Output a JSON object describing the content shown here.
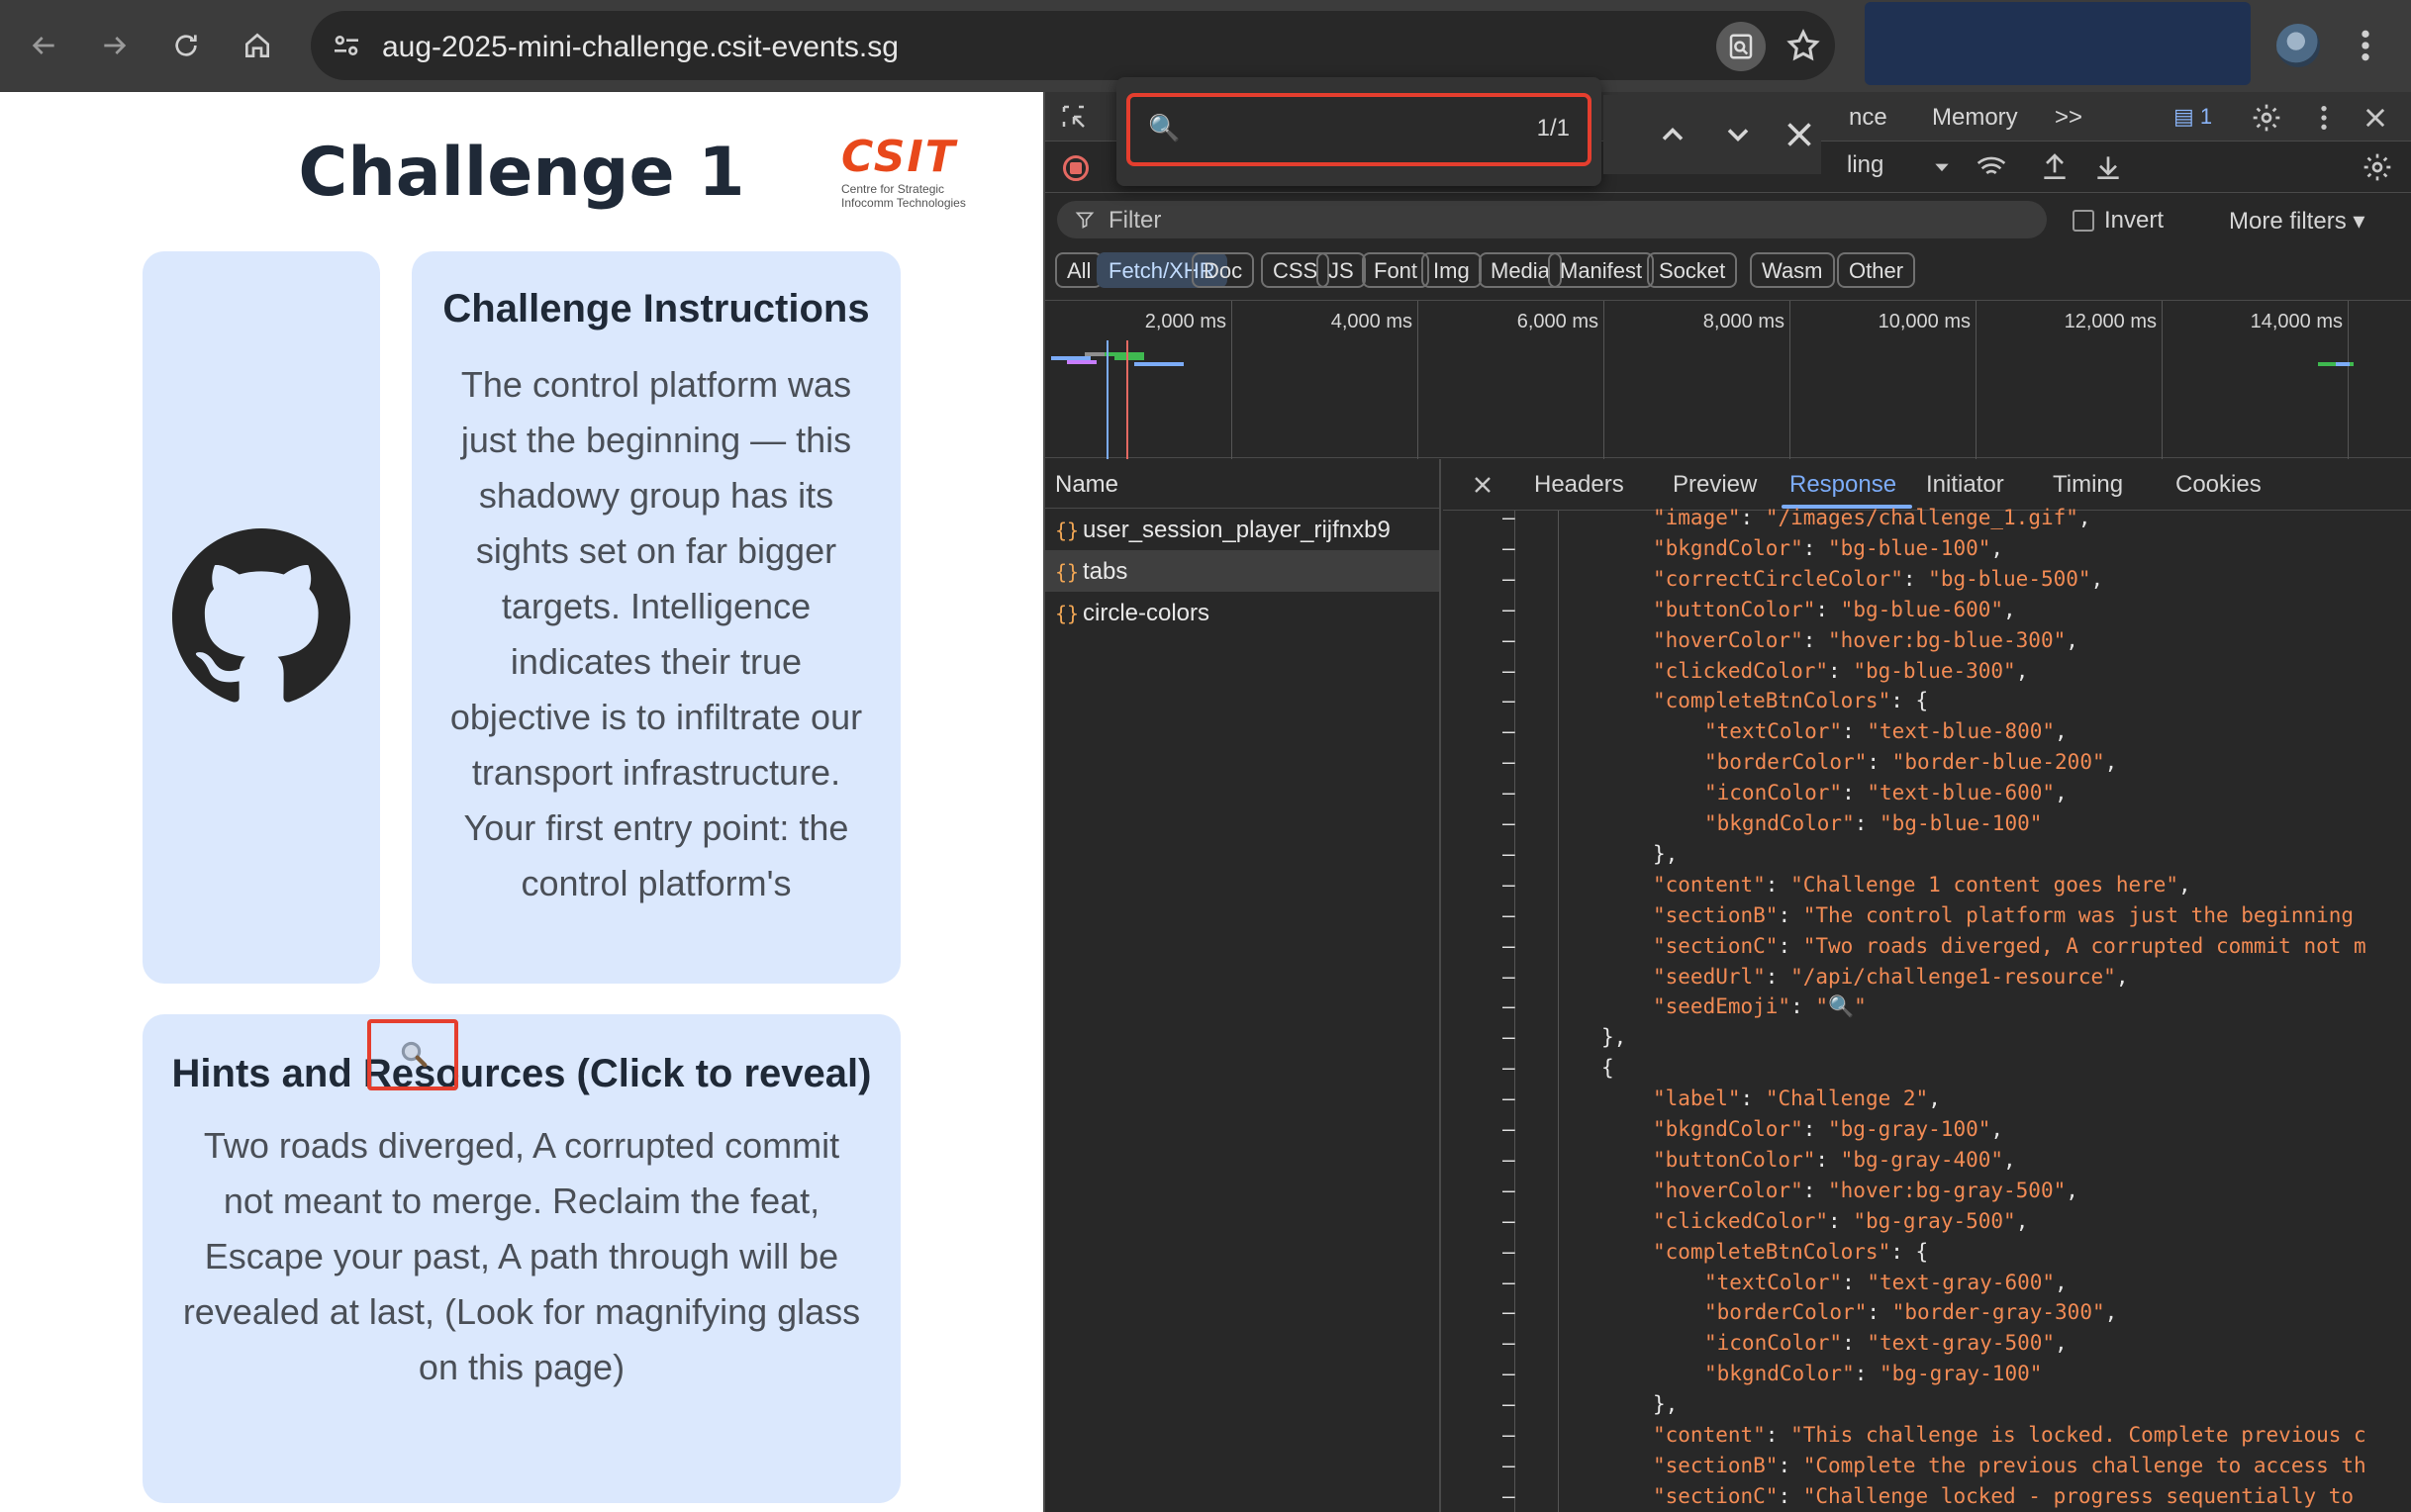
{
  "browser": {
    "url": "aug-2025-mini-challenge.csit-events.sg"
  },
  "page": {
    "title": "Challenge 1",
    "logo_mark": "CSIT",
    "logo_sub_1": "Centre for Strategic",
    "logo_sub_2": "Infocomm Technologies",
    "instructions_heading": "Challenge Instructions",
    "instructions_body": "The control platform was just the beginning — this shadowy group has its sights set on far bigger targets. Intelligence indicates their true objective is to infiltrate our transport infrastructure. Your first entry point: the control platform's development",
    "hints_heading": "Hints and Resources (Click to reveal)",
    "hints_body": "Two roads diverged, A corrupted commit not meant to merge. Reclaim the feat, Escape your past, A path through will be revealed at last, (Look for magnifying glass on this page)"
  },
  "devtools": {
    "tabs": {
      "partial": "nce",
      "memory": "Memory",
      "more": ">>",
      "issues_count": "1"
    },
    "throttling": "ling",
    "find": {
      "query": "🔍",
      "count": "1/1"
    },
    "filter_placeholder": "Filter",
    "invert_label": "Invert",
    "more_filters": "More filters",
    "type_filters": [
      "All",
      "Fetch/XHR",
      "Doc",
      "CSS",
      "JS",
      "Font",
      "Img",
      "Media",
      "Manifest",
      "Socket",
      "Wasm",
      "Other"
    ],
    "active_type": "Fetch/XHR",
    "timeline_ticks": [
      "2,000 ms",
      "4,000 ms",
      "6,000 ms",
      "8,000 ms",
      "10,000 ms",
      "12,000 ms",
      "14,000 ms"
    ],
    "name_header": "Name",
    "requests": [
      {
        "name": "user_session_player_rijfnxb9",
        "selected": false
      },
      {
        "name": "tabs",
        "selected": true
      },
      {
        "name": "circle-colors",
        "selected": false
      }
    ],
    "detail_tabs": [
      "Headers",
      "Preview",
      "Response",
      "Initiator",
      "Timing",
      "Cookies"
    ],
    "active_detail_tab": "Response",
    "response_lines": [
      {
        "indent": 2,
        "text": "\"image\": \"/images/challenge_1.gif\","
      },
      {
        "indent": 2,
        "text": "\"bkgndColor\": \"bg-blue-100\","
      },
      {
        "indent": 2,
        "text": "\"correctCircleColor\": \"bg-blue-500\","
      },
      {
        "indent": 2,
        "text": "\"buttonColor\": \"bg-blue-600\","
      },
      {
        "indent": 2,
        "text": "\"hoverColor\": \"hover:bg-blue-300\","
      },
      {
        "indent": 2,
        "text": "\"clickedColor\": \"bg-blue-300\","
      },
      {
        "indent": 2,
        "text": "\"completeBtnColors\": {"
      },
      {
        "indent": 3,
        "text": "\"textColor\": \"text-blue-800\","
      },
      {
        "indent": 3,
        "text": "\"borderColor\": \"border-blue-200\","
      },
      {
        "indent": 3,
        "text": "\"iconColor\": \"text-blue-600\","
      },
      {
        "indent": 3,
        "text": "\"bkgndColor\": \"bg-blue-100\""
      },
      {
        "indent": 2,
        "text": "},"
      },
      {
        "indent": 2,
        "text": "\"content\": \"Challenge 1 content goes here\","
      },
      {
        "indent": 2,
        "text": "\"sectionB\": \"The control platform was just the beginning"
      },
      {
        "indent": 2,
        "text": "\"sectionC\": \"Two roads diverged, A corrupted commit not m"
      },
      {
        "indent": 2,
        "text": "\"seedUrl\": \"/api/challenge1-resource\","
      },
      {
        "indent": 2,
        "text": "\"seedEmoji\": \"🔍\""
      },
      {
        "indent": 1,
        "text": "},"
      },
      {
        "indent": 1,
        "text": "{"
      },
      {
        "indent": 2,
        "text": "\"label\": \"Challenge 2\","
      },
      {
        "indent": 2,
        "text": "\"bkgndColor\": \"bg-gray-100\","
      },
      {
        "indent": 2,
        "text": "\"buttonColor\": \"bg-gray-400\","
      },
      {
        "indent": 2,
        "text": "\"hoverColor\": \"hover:bg-gray-500\","
      },
      {
        "indent": 2,
        "text": "\"clickedColor\": \"bg-gray-500\","
      },
      {
        "indent": 2,
        "text": "\"completeBtnColors\": {"
      },
      {
        "indent": 3,
        "text": "\"textColor\": \"text-gray-600\","
      },
      {
        "indent": 3,
        "text": "\"borderColor\": \"border-gray-300\","
      },
      {
        "indent": 3,
        "text": "\"iconColor\": \"text-gray-500\","
      },
      {
        "indent": 3,
        "text": "\"bkgndColor\": \"bg-gray-100\""
      },
      {
        "indent": 2,
        "text": "},"
      },
      {
        "indent": 2,
        "text": "\"content\": \"This challenge is locked. Complete previous c"
      },
      {
        "indent": 2,
        "text": "\"sectionB\": \"Complete the previous challenge to access th"
      },
      {
        "indent": 2,
        "text": "\"sectionC\": \"Challenge locked - progress sequentially to"
      }
    ]
  },
  "colors": {
    "card_bg": "#dbe8fd",
    "highlight_red": "#e53e2e",
    "json_string": "#f28b54",
    "active_tab_blue": "#7cacf8"
  }
}
